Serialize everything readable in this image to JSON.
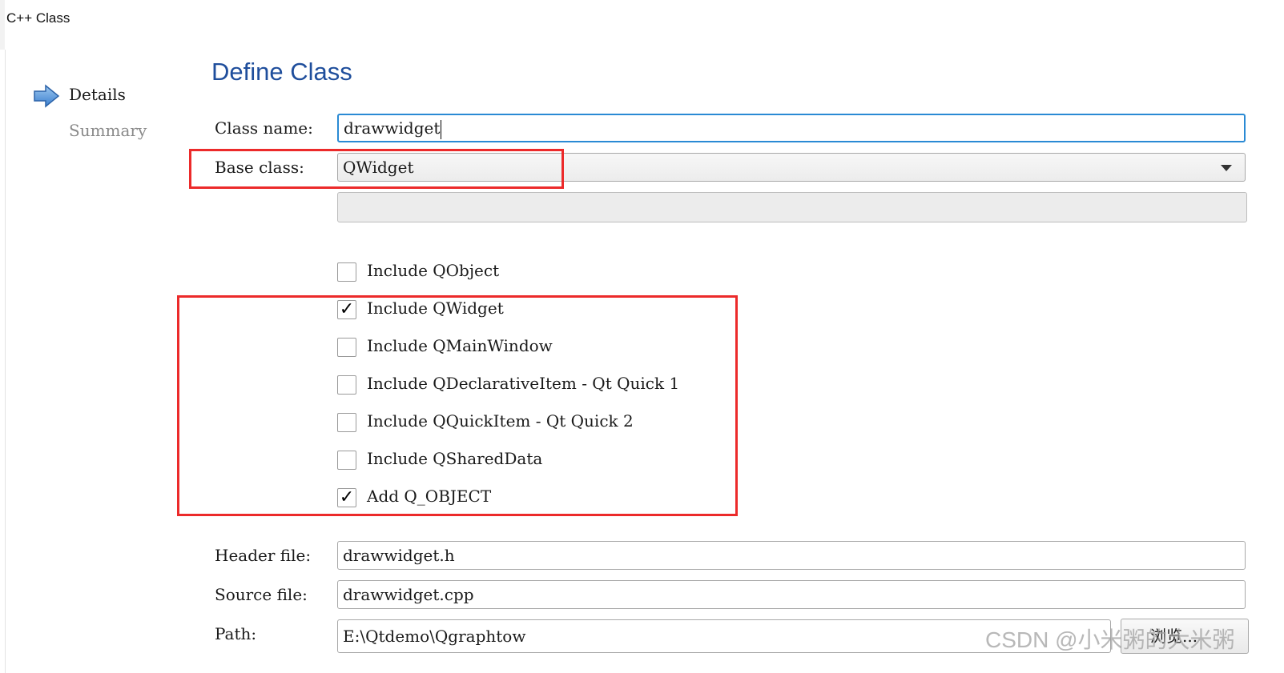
{
  "window": {
    "title": "C++ Class"
  },
  "nav": {
    "items": [
      {
        "label": "Details"
      },
      {
        "label": "Summary"
      }
    ]
  },
  "page": {
    "title": "Define Class"
  },
  "form": {
    "class_name": {
      "label": "Class name:",
      "value": "drawwidget"
    },
    "base_class": {
      "label": "Base class:",
      "value": "QWidget"
    },
    "options": [
      {
        "label": "Include QObject",
        "checked": false
      },
      {
        "label": "Include QWidget",
        "checked": true
      },
      {
        "label": "Include QMainWindow",
        "checked": false
      },
      {
        "label": "Include QDeclarativeItem - Qt Quick 1",
        "checked": false
      },
      {
        "label": "Include QQuickItem - Qt Quick 2",
        "checked": false
      },
      {
        "label": "Include QSharedData",
        "checked": false
      },
      {
        "label": "Add Q_OBJECT",
        "checked": true
      }
    ],
    "header_file": {
      "label": "Header file:",
      "value": "drawwidget.h"
    },
    "source_file": {
      "label": "Source file:",
      "value": "drawwidget.cpp"
    },
    "path": {
      "label": "Path:",
      "value": "E:\\Qtdemo\\Qgraphtow"
    },
    "browse_label": "浏览..."
  },
  "watermark": "CSDN @小米粥的大米粥",
  "colors": {
    "accent": "#2a8ad4",
    "title": "#1f4e9c",
    "highlight": "#ec2a2a"
  }
}
